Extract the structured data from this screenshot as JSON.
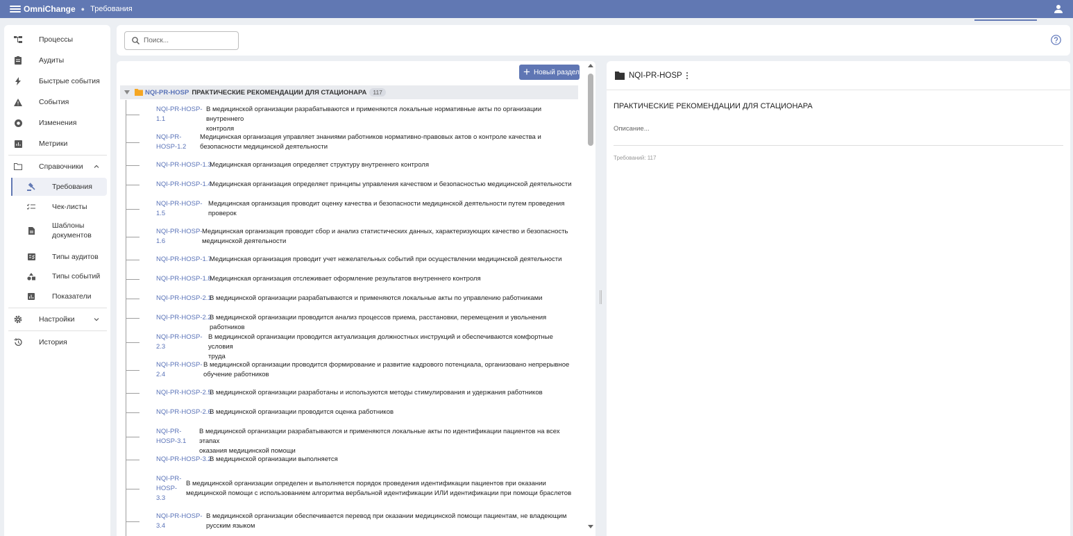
{
  "topbar": {
    "brand": "OmniChange",
    "breadcrumb": "Требования"
  },
  "search": {
    "placeholder": "Поиск..."
  },
  "sidebar": {
    "items": [
      {
        "label": "Процессы",
        "icon": "process-icon"
      },
      {
        "label": "Аудиты",
        "icon": "clipboard-icon"
      },
      {
        "label": "Быстрые события",
        "icon": "bolt-icon"
      },
      {
        "label": "События",
        "icon": "warning-icon"
      },
      {
        "label": "Изменения",
        "icon": "change-icon"
      },
      {
        "label": "Метрики",
        "icon": "chart-icon"
      }
    ],
    "directories": {
      "label": "Справочники",
      "children": [
        {
          "label": "Требования",
          "icon": "gavel-icon"
        },
        {
          "label": "Чек-листы",
          "icon": "checklist-icon"
        },
        {
          "label": "Шаблоны документов",
          "icon": "document-icon"
        },
        {
          "label": "Типы аудитов",
          "icon": "audit-type-icon"
        },
        {
          "label": "Типы событий",
          "icon": "shapes-icon"
        },
        {
          "label": "Показатели",
          "icon": "bar-chart-icon"
        }
      ]
    },
    "settings": "Настройки",
    "history": "История"
  },
  "list": {
    "new_section_button": "Новый раздел",
    "section": {
      "code": "NQI-PR-HOSP",
      "title": "ПРАКТИЧЕСКИЕ РЕКОМЕНДАЦИИ ДЛЯ СТАЦИОНАРА",
      "count": "117"
    },
    "requirements": [
      {
        "code": [
          "NQI-PR-HOSP-",
          "1.1"
        ],
        "text": [
          "В медицинской организации разрабатываются и применяются локальные нормативные акты по организации внутреннего",
          "контроля"
        ]
      },
      {
        "code": [
          "NQI-PR-",
          "HOSP-1.2"
        ],
        "text": [
          "Медицинская организация управляет знаниями работников нормативно-правовых актов о контроле качества и",
          "безопасности медицинской деятельности"
        ]
      },
      {
        "code": [
          "NQI-PR-HOSP-1.3"
        ],
        "text": [
          "Медицинская организация определяет структуру внутреннего контроля"
        ]
      },
      {
        "code": [
          "NQI-PR-HOSP-1.4"
        ],
        "text": [
          "Медицинская организация определяет принципы управления качеством и безопасностью медицинской деятельности"
        ]
      },
      {
        "code": [
          "NQI-PR-HOSP-",
          "1.5"
        ],
        "text": [
          "Медицинская организация проводит оценку качества и безопасности медицинской деятельности путем проведения",
          "проверок"
        ]
      },
      {
        "code": [
          "NQI-PR-HOSP-",
          "1.6"
        ],
        "text": [
          "Медицинская организация проводит сбор и анализ статистических данных, характеризующих качество и безопасность",
          "медицинской деятельности"
        ]
      },
      {
        "code": [
          "NQI-PR-HOSP-1.7"
        ],
        "text": [
          "Медицинская организация проводит учет нежелательных событий при осуществлении медицинской деятельности"
        ]
      },
      {
        "code": [
          "NQI-PR-HOSP-1.8"
        ],
        "text": [
          "Медицинская организация отслеживает оформление результатов внутреннего контроля"
        ]
      },
      {
        "code": [
          "NQI-PR-HOSP-2.1"
        ],
        "text": [
          "В медицинской организации разрабатываются и применяются локальные акты по управлению работниками"
        ]
      },
      {
        "code": [
          "NQI-PR-HOSP-2.2"
        ],
        "text": [
          "В медицинской организации проводится анализ процессов приема, расстановки, перемещения и увольнения работников"
        ]
      },
      {
        "code": [
          "NQI-PR-HOSP-",
          "2.3"
        ],
        "text": [
          "В медицинской организации проводится актуализация должностных инструкций и обеспечиваются комфортные условия",
          "труда"
        ]
      },
      {
        "code": [
          "NQI-PR-HOSP-",
          "2.4"
        ],
        "text": [
          "В медицинской организации проводится формирование и развитие кадрового потенциала, организовано непрерывное",
          "обучение работников"
        ]
      },
      {
        "code": [
          "NQI-PR-HOSP-2.5"
        ],
        "text": [
          "В медицинской организации разработаны и используются методы стимулирования и удержания работников"
        ]
      },
      {
        "code": [
          "NQI-PR-HOSP-2.6"
        ],
        "text": [
          "В медицинской организации проводится оценка работников"
        ]
      },
      {
        "code": [
          "NQI-PR-",
          "HOSP-3.1"
        ],
        "text": [
          "В медицинской организации разрабатываются и применяются локальные акты по идентификации пациентов на всех этапах",
          "оказания медицинской помощи"
        ]
      },
      {
        "code": [
          "NQI-PR-HOSP-3.2"
        ],
        "text": [
          "В медицинской организации выполняется"
        ]
      },
      {
        "code": [
          "NQI-PR-",
          "HOSP-",
          "3.3"
        ],
        "text": [
          "В медицинской организации определен и выполняется порядок проведения идентификации пациентов при оказании",
          "медицинской помощи с использованием алгоритма вербальной идентификации ИЛИ идентификации при помощи браслетов"
        ]
      },
      {
        "code": [
          "NQI-PR-HOSP-",
          "3.4"
        ],
        "text": [
          "В медицинской организации обеспечивается перевод при оказании медицинской помощи пациентам, не владеющим",
          "русским языком"
        ]
      }
    ]
  },
  "detail": {
    "name": "NQI-PR-HOSP",
    "title": "ПРАКТИЧЕСКИЕ РЕКОМЕНДАЦИИ ДЛЯ СТАЦИОНАРА",
    "description_placeholder": "Описание...",
    "requirements_count": "Требований: 117"
  },
  "colors": {
    "accent": "#6178b3",
    "folder": "#f5a623",
    "link": "#5a73b8"
  }
}
